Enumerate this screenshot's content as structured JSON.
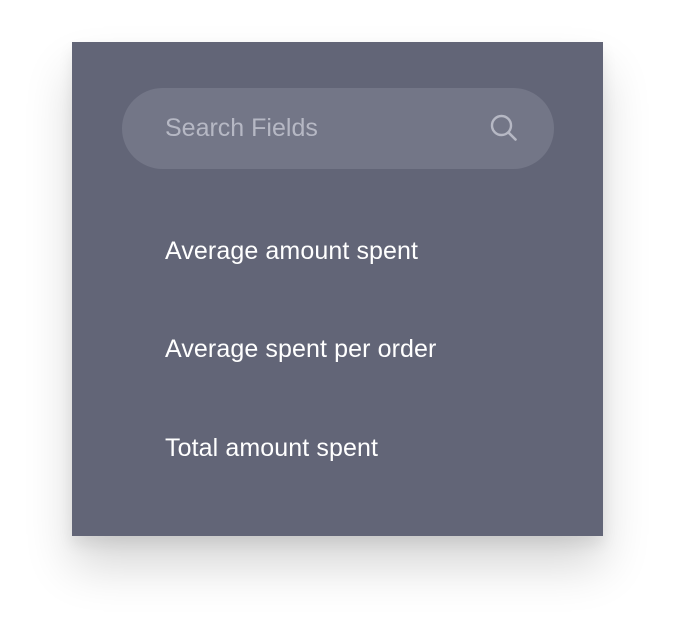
{
  "search": {
    "placeholder": "Search Fields",
    "value": ""
  },
  "fields": [
    {
      "label": "Average amount spent"
    },
    {
      "label": "Average spent per order"
    },
    {
      "label": "Total amount spent"
    }
  ],
  "icons": {
    "search": "search-icon"
  },
  "colors": {
    "panel_background": "#626577",
    "search_background": "#737687",
    "placeholder": "#b6b8c4",
    "text": "#ffffff"
  }
}
